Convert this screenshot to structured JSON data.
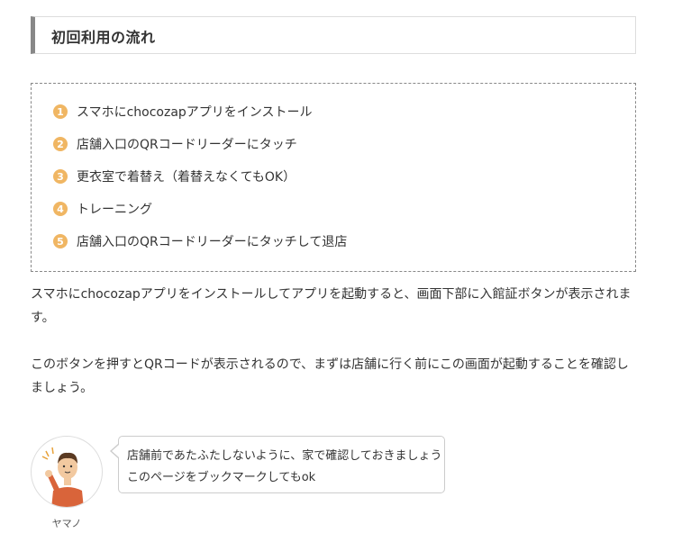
{
  "section_title": "初回利用の流れ",
  "steps": [
    {
      "num": "1",
      "text": "スマホにchocozapアプリをインストール"
    },
    {
      "num": "2",
      "text": "店舗入口のQRコードリーダーにタッチ"
    },
    {
      "num": "3",
      "text": "更衣室で着替え（着替えなくてもOK）"
    },
    {
      "num": "4",
      "text": "トレーニング"
    },
    {
      "num": "5",
      "text": "店舗入口のQRコードリーダーにタッチして退店"
    }
  ],
  "paragraphs": [
    "スマホにchocozapアプリをインストールしてアプリを起動すると、画面下部に入館証ボタンが表示されます。",
    "このボタンを押すとQRコードが表示されるので、まずは店舗に行く前にこの画面が起動することを確認しましょう。"
  ],
  "speech": {
    "speaker_name": "ヤマノ",
    "lines": [
      "店舗前であたふたしないように、家で確認しておきましょう",
      "このページをブックマークしてもok"
    ]
  },
  "colors": {
    "accent": "#f0b663",
    "heading_bar": "#888888",
    "border": "#dddddd"
  }
}
